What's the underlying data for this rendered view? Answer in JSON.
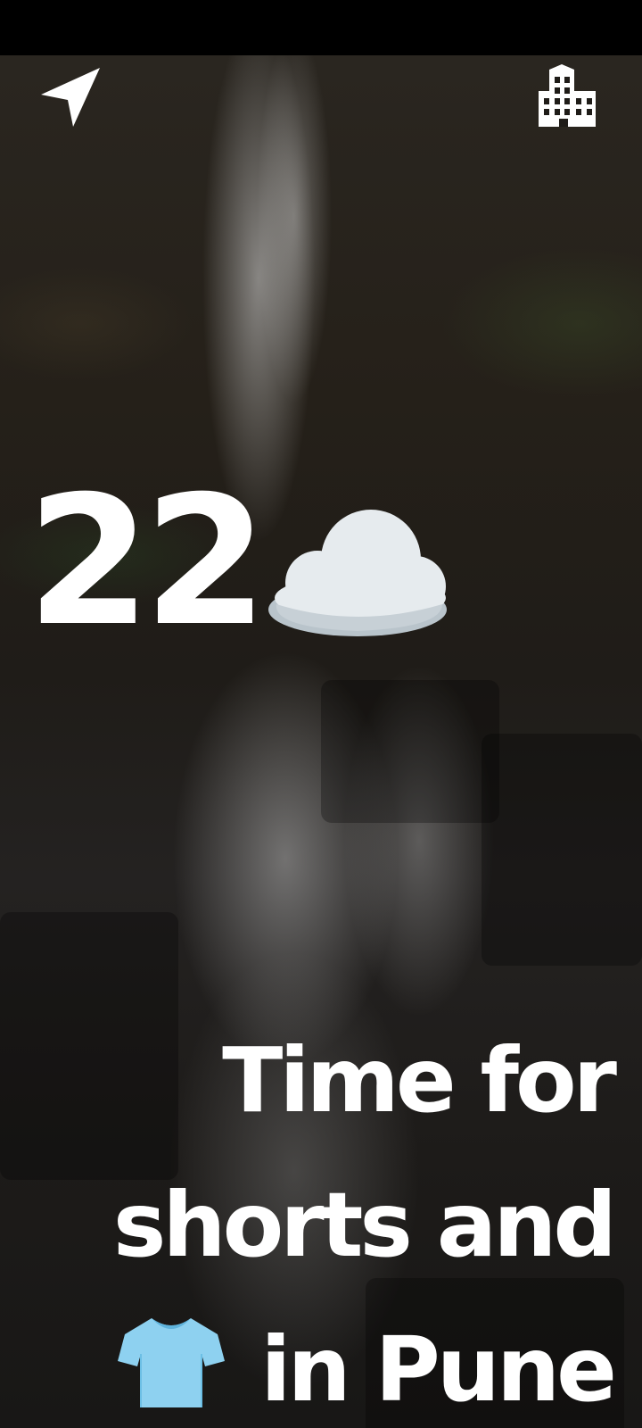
{
  "weather": {
    "temperature": "22",
    "condition_icon": "cloud-icon"
  },
  "toolbar": {
    "left_icon": "navigation-arrow-icon",
    "right_icon": "city-building-icon"
  },
  "message": {
    "line1": "Time for",
    "line2": "shorts and",
    "clothing_icon": "tshirt-icon",
    "line3": "in Pune"
  },
  "colors": {
    "text": "#FFFFFF",
    "cloud": "#E6EBEE",
    "tshirt": "#8ED1F0"
  }
}
